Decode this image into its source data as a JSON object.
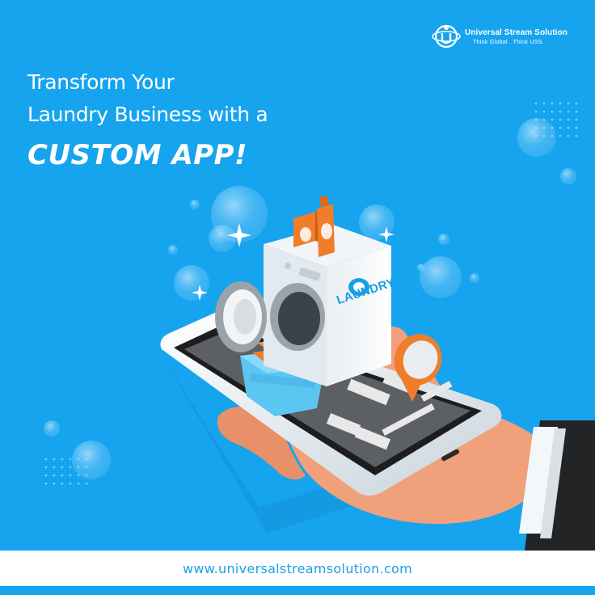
{
  "headline": {
    "line1": "Transform Your",
    "line2": "Laundry Business with a",
    "line3": "CUSTOM APP!"
  },
  "brand": {
    "name": "Universal Stream Solution",
    "tagline": "Think Global . Think USS."
  },
  "illustration": {
    "machine_label": "LAUNDRY"
  },
  "footer": {
    "url": "www.universalstreamsolution.com"
  },
  "colors": {
    "background": "#16a4ef",
    "accent_orange": "#f07d2a",
    "footer_bg": "#ffffff",
    "url_text": "#1a9fe6"
  }
}
